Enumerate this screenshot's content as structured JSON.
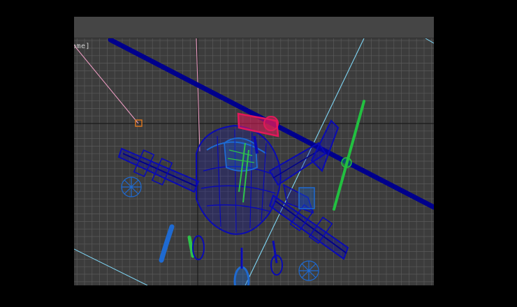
{
  "viewport": {
    "label": "ome]",
    "background": "#3c3c3c",
    "header_color": "#454545",
    "grid_color": "#5a5a5a",
    "axis_color": "#1a1a1a"
  },
  "scene": {
    "model": "helicopter-wireframe",
    "colors": {
      "body": "#0a0ab4",
      "rotor_blade": "#00008c",
      "rotor_hub": "#e0185a",
      "tail_rotor": "#22c040",
      "light_blue_parts": "#1e6ad2",
      "green_parts": "#2ec24a",
      "camera_line": "#7fd6f5",
      "target_line": "#f5a0c8",
      "target_marker": "#e0781e"
    }
  }
}
